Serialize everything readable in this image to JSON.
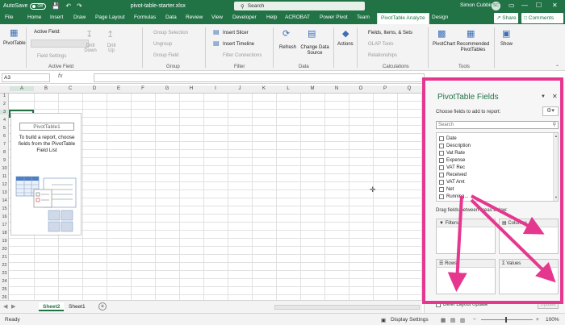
{
  "titlebar": {
    "autosave_label": "AutoSave",
    "autosave_state": "Off",
    "filename": "pivot-table-starter.xlsx",
    "search_placeholder": "Search",
    "user_name": "Simon Cubbin",
    "user_initials": "SC"
  },
  "menu": {
    "tabs": [
      "File",
      "Home",
      "Insert",
      "Draw",
      "Page Layout",
      "Formulas",
      "Data",
      "Review",
      "View",
      "Developer",
      "Help",
      "ACROBAT",
      "Power Pivot",
      "Team",
      "PivotTable Analyze",
      "Design"
    ],
    "active_tab": "PivotTable Analyze",
    "share_label": "Share",
    "comments_label": "Comments"
  },
  "ribbon": {
    "pivottable_btn": "PivotTable",
    "active_field_label": "Active Field:",
    "field_settings": "Field Settings",
    "drill_down": "Drill Down",
    "drill_up": "Drill Up",
    "group_selection": "Group Selection",
    "ungroup": "Ungroup",
    "group_field": "Group Field",
    "insert_slicer": "Insert Slicer",
    "insert_timeline": "Insert Timeline",
    "filter_connections": "Filter Connections",
    "refresh": "Refresh",
    "change_data_source": "Change Data Source",
    "actions": "Actions",
    "fields_items_sets": "Fields, Items, & Sets",
    "olap_tools": "OLAP Tools",
    "relationships": "Relationships",
    "pivotchart": "PivotChart",
    "recommended_pivottables": "Recommended PivotTables",
    "show": "Show",
    "groups": {
      "active_field": "Active Field",
      "group": "Group",
      "filter": "Filter",
      "data": "Data",
      "calculations": "Calculations",
      "tools": "Tools"
    }
  },
  "formula": {
    "cell_ref": "A3",
    "fx_label": "fx"
  },
  "grid": {
    "columns": [
      "A",
      "B",
      "C",
      "D",
      "E",
      "F",
      "G",
      "H",
      "I",
      "J",
      "K",
      "L",
      "M",
      "N",
      "O",
      "P",
      "Q"
    ],
    "rows": [
      "1",
      "2",
      "3",
      "4",
      "5",
      "6",
      "7",
      "8",
      "9",
      "10",
      "11",
      "12",
      "13",
      "14",
      "15",
      "16",
      "17",
      "18",
      "19",
      "20",
      "21",
      "22",
      "23",
      "24",
      "25",
      "26"
    ]
  },
  "pivot_placeholder": {
    "title": "PivotTable1",
    "description": "To build a report, choose fields from the PivotTable Field List"
  },
  "sheets": {
    "tabs": [
      "Sheet2",
      "Sheet1"
    ],
    "active": "Sheet2"
  },
  "status": {
    "ready": "Ready",
    "display_settings": "Display Settings",
    "zoom": "100%"
  },
  "pane": {
    "title": "PivotTable Fields",
    "subtitle": "Choose fields to add to report:",
    "search_placeholder": "Search",
    "fields": [
      "Date",
      "Description",
      "Vat Rate",
      "Expense",
      "VAT Rec",
      "Received",
      "VAT Amt",
      "Net",
      "Running..."
    ],
    "drag_label": "Drag fields between areas below:",
    "areas": {
      "filters": "Filters",
      "columns": "Columns",
      "rows": "Rows",
      "values": "Values"
    },
    "defer_label": "Defer Layout Update",
    "update_label": "Update"
  },
  "colors": {
    "excel_green": "#217346",
    "highlight_pink": "#e6378f"
  }
}
